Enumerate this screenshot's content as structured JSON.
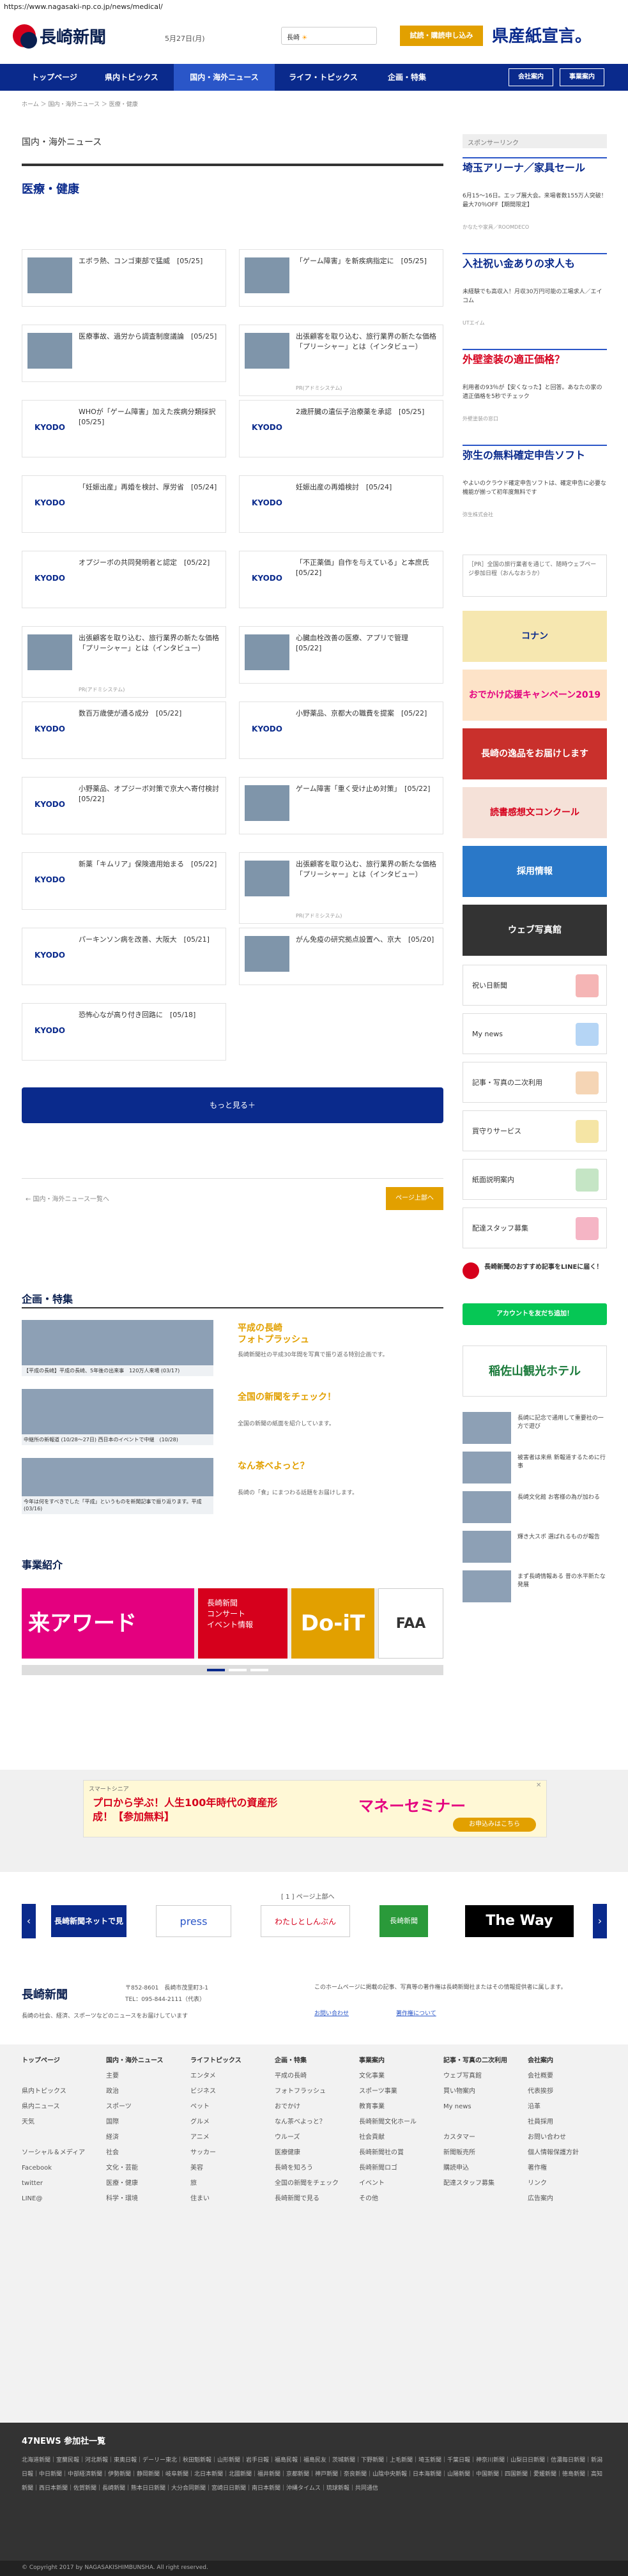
{
  "url": "https://www.nagasaki-np.co.jp/news/medical/",
  "header": {
    "logo": "長崎新聞",
    "date": "5月27日(月)",
    "weather_label": "長崎",
    "subscribe": "試読・購読申し込み",
    "banner": "県産紙宣言。"
  },
  "nav": [
    "トップページ",
    "県内トピックス",
    "国内・海外ニュース",
    "ライフ・トピックス",
    "企画・特集",
    "会社案内",
    "事業案内"
  ],
  "breadcrumb": "ホーム ＞ 国内・海外ニュース ＞ 医療・健康",
  "section": {
    "label": "国内・海外ニュース",
    "title": "医療・健康"
  },
  "articles": [
    {
      "t": "エボラ熱、コンゴ東部で猛威　[05/25]",
      "kyodo": false
    },
    {
      "t": "「ゲーム障害」を新疾病指定に　[05/25]",
      "kyodo": false
    },
    {
      "t": "医療事故、過労から調査制度議論　[05/25]",
      "kyodo": false
    },
    {
      "t": "出張顧客を取り込む、旅行業界の新たな価格「プリーシャー」とは（インタビュー）",
      "kyodo": false,
      "pr": "PR(アドミシステム)"
    },
    {
      "t": "WHOが「ゲーム障害」加えた疾病分類採択　[05/25]",
      "kyodo": true
    },
    {
      "t": "2歳肝臓の遺伝子治療薬を承認　[05/25]",
      "kyodo": true
    },
    {
      "t": "「妊娠出産」再婚を検討、厚労省　[05/24]",
      "kyodo": true
    },
    {
      "t": "妊娠出産の再婚検討　[05/24]",
      "kyodo": true
    },
    {
      "t": "オプジーボの共同発明者と認定　[05/22]",
      "kyodo": true
    },
    {
      "t": "「不正薬価」自作を与えている」と本庶氏　[05/22]",
      "kyodo": true
    },
    {
      "t": "出張顧客を取り込む、旅行業界の新たな価格「プリーシャー」とは（インタビュー）",
      "kyodo": false,
      "pr": "PR(アドミシステム)"
    },
    {
      "t": "心臓血栓改善の医療、アプリで管理　[05/22]",
      "kyodo": false
    },
    {
      "t": "数百万歳使が通る成分　[05/22]",
      "kyodo": true
    },
    {
      "t": "小野薬品、京都大の職費を提案　[05/22]",
      "kyodo": true
    },
    {
      "t": "小野薬品、オプジーボ対策で京大へ寄付検討　[05/22]",
      "kyodo": true
    },
    {
      "t": "ゲーム障害「重く受け止め対策」　[05/22]",
      "kyodo": false
    },
    {
      "t": "新薬「キムリア」保険適用始まる　[05/22]",
      "kyodo": true
    },
    {
      "t": "出張顧客を取り込む、旅行業界の新たな価格「プリーシャー」とは（インタビュー）",
      "kyodo": false,
      "pr": "PR(アドミシステム)"
    },
    {
      "t": "パーキンソン病を改善、大阪大　[05/21]",
      "kyodo": true
    },
    {
      "t": "がん免疫の研究拠点設置へ、京大　[05/20]",
      "kyodo": false
    },
    {
      "t": "恐怖心なが高り付き回路に　[05/18]",
      "kyodo": true
    }
  ],
  "more_button": "もっと見る＋",
  "page_prev": "← 国内・海外ニュース一覧へ",
  "page_top": "ページ上部へ",
  "feature": {
    "title": "企画・特集",
    "items": [
      {
        "cap": "【平成の長崎】平成の長崎、5年後の出来事　120万人来場 (03/17)",
        "head": "平成の長崎\nフォトプラッシュ",
        "body": "長崎新聞社の平成30年間を写真で振り返る特別企画です。"
      },
      {
        "cap": "中継所の新報道 (10/28〜27日) 西日本のイベントで中継　(10/28)",
        "head": "全国の新聞をチェック！",
        "body": "全国の新聞の紙面を紹介しています。"
      },
      {
        "cap": "今年は何をすべきでした「平成」というものを新聞記事で振り返ります。平成 (03/16)",
        "head": "なん茶べよっと？",
        "body": "長崎の「食」にまつわる話題をお届けします。"
      }
    ]
  },
  "business": {
    "title": "事業紹介"
  },
  "ad": {
    "small": "スマートシニア",
    "main": "プロから学ぶ！人生100年時代の資産形成！【参加無料】",
    "right": "マネーセミナー",
    "cta": "お申込みはこちら"
  },
  "partners_nav": "[ 1 ] ページ上部へ",
  "partners": [
    "長崎新聞ネットで見",
    "press",
    "わたしとしんぶん",
    "長崎新聞",
    "The Way"
  ],
  "footer": {
    "logo": "長崎新聞",
    "addr": "〒852-8601　長崎市茂里町3-1",
    "tel": "TEL：095-844-2111（代表）",
    "note": "長崎の社会、経済、スポーツなどのニュースをお届けしています",
    "copyright_note": "このホームページに掲載の記事、写真等の著作権は長崎新聞社またはその情報提供者に属します。",
    "links": [
      "お問い合わせ",
      "著作権について"
    ],
    "cols": [
      [
        "トップページ",
        "",
        "県内トピックス",
        "県内ニュース",
        "天気",
        "",
        "ソーシャル＆メディア",
        "Facebook",
        "twitter",
        "LINE@"
      ],
      [
        "国内・海外ニュース",
        "主要",
        "政治",
        "スポーツ",
        "国際",
        "経済",
        "社会",
        "文化・芸能",
        "医療・健康",
        "科学・環境"
      ],
      [
        "ライフトピックス",
        "エンタメ",
        "ビジネス",
        "ペット",
        "グルメ",
        "アニメ",
        "サッカー",
        "美容",
        "旅",
        "住まい"
      ],
      [
        "企画・特集",
        "平成の長崎",
        "フォトフラッシュ",
        "おでかけ",
        "なん茶べよっと？",
        "ウルーズ",
        "医療健康",
        "長崎を知ろう",
        "全国の新聞をチェック",
        "長崎新聞で見る"
      ],
      [
        "事業案内",
        "文化事業",
        "スポーツ事業",
        "教育事業",
        "長崎新聞文化ホール",
        "社会貢献",
        "長崎新聞社の賞",
        "長崎新聞ロゴ",
        "イベント",
        "その他"
      ],
      [
        "記事・写真の二次利用",
        "ウェブ写真館",
        "買い物案内",
        "My news",
        "",
        "カスタマー",
        "新聞販売所",
        "購読申込",
        "配達スタッフ募集",
        ""
      ],
      [
        "会社案内",
        "会社概要",
        "代表挨拶",
        "沿革",
        "社員採用",
        "お問い合わせ",
        "個人情報保護方針",
        "著作権",
        "リンク",
        "広告案内"
      ]
    ]
  },
  "n47": {
    "title": "47NEWS 参加社一覧",
    "text": "北海道新聞｜室蘭民報｜河北新報｜東奥日報｜デーリー東北｜秋田魁新報｜山形新聞｜岩手日報｜福島民報｜福島民友｜茨城新聞｜下野新聞｜上毛新聞｜埼玉新聞｜千葉日報｜神奈川新聞｜山梨日日新聞｜信濃毎日新聞｜新潟日報｜中日新聞｜中部経済新聞｜伊勢新聞｜静岡新聞｜岐阜新聞｜北日本新聞｜北國新聞｜福井新聞｜京都新聞｜神戸新聞｜奈良新聞｜山陰中央新報｜日本海新聞｜山陽新聞｜中国新聞｜四国新聞｜愛媛新聞｜徳島新聞｜高知新聞｜西日本新聞｜佐賀新聞｜長崎新聞｜熊本日日新聞｜大分合同新聞｜宮崎日日新聞｜南日本新聞｜沖縄タイムス｜琉球新報｜共同通信"
  },
  "copyright": "© Copyright 2017 by NAGASAKISHIMBUNSHA. All right reserved.",
  "sidebar": {
    "sponsor": "スポンサーリンク",
    "ads": [
      {
        "h": "埼玉アリーナ／家具セール",
        "b": "6月15〜16日。エップ展大会。来場者数155万人突破！最大70％OFF【期間限定】",
        "src": "かなたや家具／ROOMDECO"
      },
      {
        "h": "入社祝い金ありの求人も",
        "b": "未経験でも高収入！月収30万円可能の工場求人／エイコム",
        "src": "UTエイム"
      },
      {
        "h": "外壁塗装の適正価格？",
        "b": "利用者の93％が【安くなった】と回答。あなたの家の適正価格を5秒でチェック",
        "src": "外壁塗装の窓口"
      },
      {
        "h": "弥生の無料確定申告ソフト",
        "b": "やよいのクラウド確定申告ソフトは、確定申告に必要な機能が揃って初年度無料です",
        "src": "弥生株式会社"
      }
    ],
    "notice": "［PR］全国の旅行業者を通じて、随時ウェブページ参加日程（おんなおうか）",
    "banners": [
      "コナン",
      "おでかけ応援キャンペーン2019",
      "長崎の逸品をお届けします",
      "読書感想文コンクール",
      "採用情報",
      "ウェブ写真館"
    ],
    "links": [
      "祝い日新聞",
      "My news",
      "記事・写真の二次利用",
      "買守りサービス",
      "紙面説明案内",
      "配達スタッフ募集"
    ],
    "line": {
      "t": "長崎新聞のおすすめ記事をLINEに届く！",
      "btn": "アカウントを友だち追加！"
    },
    "hotel": "稲佐山観光ホテル",
    "news": [
      "長崎に記念で通用して重要社の一方で遊び",
      "被害者は来県 新報道するために行事",
      "長崎文化館 お客様の為が加わる",
      "輝き大スポ 選ばれるものが報告",
      "まず長崎情報ある 昔の水平新たな発展"
    ]
  }
}
